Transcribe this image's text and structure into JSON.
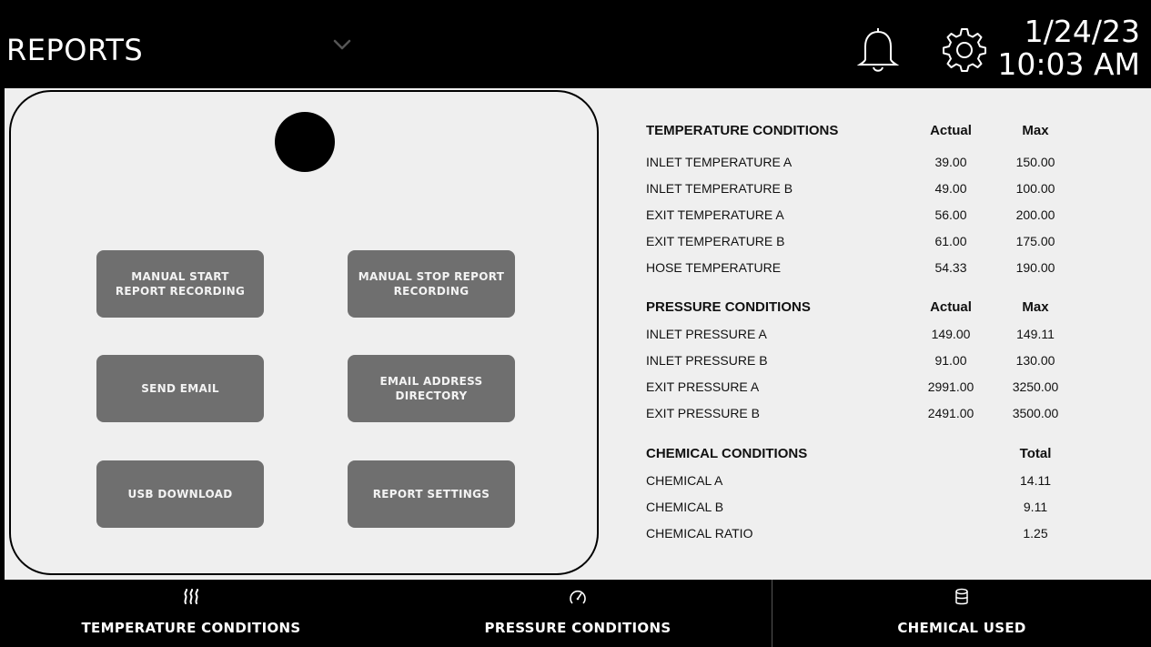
{
  "header": {
    "title": "REPORTS",
    "date": "1/24/23",
    "time": "10:03 AM",
    "icons": [
      "chevron-down-icon",
      "bell-icon",
      "gear-icon"
    ]
  },
  "actions": {
    "manual_start": "MANUAL START REPORT RECORDING",
    "manual_stop": "MANUAL STOP REPORT RECORDING",
    "send_email": "SEND EMAIL",
    "email_directory": "EMAIL ADDRESS DIRECTORY",
    "usb_download": "USB DOWNLOAD",
    "report_settings": "REPORT SETTINGS"
  },
  "temperature": {
    "heading": "TEMPERATURE CONDITIONS",
    "col_actual": "Actual",
    "col_max": "Max",
    "rows": [
      {
        "label": "INLET TEMPERATURE A",
        "actual": "39.00",
        "max": "150.00"
      },
      {
        "label": "INLET TEMPERATURE B",
        "actual": "49.00",
        "max": "100.00"
      },
      {
        "label": "EXIT TEMPERATURE A",
        "actual": "56.00",
        "max": "200.00"
      },
      {
        "label": "EXIT TEMPERATURE B",
        "actual": "61.00",
        "max": "175.00"
      },
      {
        "label": "HOSE TEMPERATURE",
        "actual": "54.33",
        "max": "190.00"
      }
    ]
  },
  "pressure": {
    "heading": "PRESSURE CONDITIONS",
    "col_actual": "Actual",
    "col_max": "Max",
    "rows": [
      {
        "label": "INLET PRESSURE A",
        "actual": "149.00",
        "max": "149.11"
      },
      {
        "label": "INLET PRESSURE B",
        "actual": "91.00",
        "max": "130.00"
      },
      {
        "label": "EXIT PRESSURE A",
        "actual": "2991.00",
        "max": "3250.00"
      },
      {
        "label": "EXIT PRESSURE B",
        "actual": "2491.00",
        "max": "3500.00"
      }
    ]
  },
  "chemical": {
    "heading": "CHEMICAL CONDITIONS",
    "col_total": "Total",
    "rows": [
      {
        "label": "CHEMICAL A",
        "total": "14.11"
      },
      {
        "label": "CHEMICAL B",
        "total": "9.11"
      },
      {
        "label": "CHEMICAL RATIO",
        "total": "1.25"
      }
    ]
  },
  "bottom_nav": [
    {
      "label": "TEMPERATURE CONDITIONS",
      "icon": "heat-waves-icon"
    },
    {
      "label": "PRESSURE CONDITIONS",
      "icon": "gauge-icon"
    },
    {
      "label": "CHEMICAL USED",
      "icon": "database-icon"
    }
  ],
  "colors": {
    "header_bg": "#000000",
    "content_bg": "#efefef",
    "button_bg": "#6f6f6f",
    "button_text": "#f3f3f3"
  }
}
